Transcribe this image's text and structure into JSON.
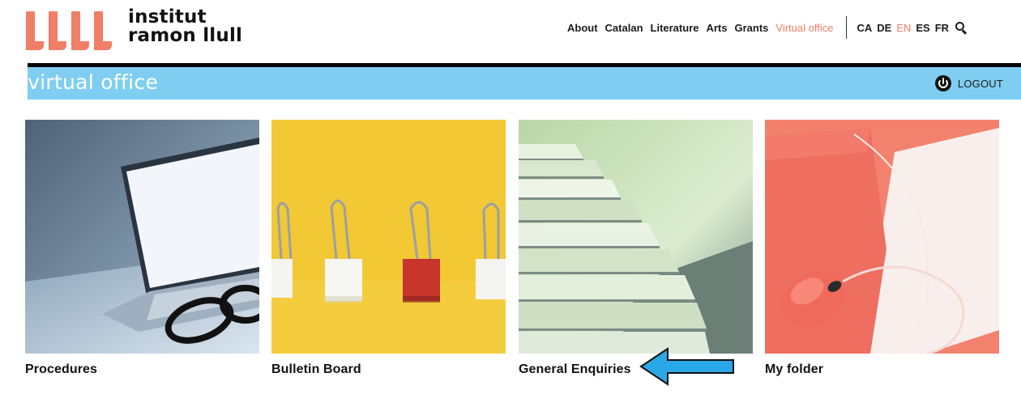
{
  "brand": {
    "logo_line1": "institut",
    "logo_line2": "ramon llull",
    "accent_color": "#ef7f67"
  },
  "nav": {
    "items": [
      "About",
      "Catalan",
      "Literature",
      "Arts",
      "Grants",
      "Virtual office"
    ],
    "active": "Virtual office"
  },
  "languages": {
    "items": [
      "CA",
      "DE",
      "EN",
      "ES",
      "FR"
    ],
    "active": "EN"
  },
  "band": {
    "title": "virtual office",
    "logout_label": "LOGOUT",
    "color": "#7fcef2"
  },
  "cards": [
    {
      "label": "Procedures",
      "image": "laptop-and-glasses-photo"
    },
    {
      "label": "Bulletin Board",
      "image": "binder-clips-photo"
    },
    {
      "label": "General Enquiries",
      "image": "paper-stacks-photo"
    },
    {
      "label": "My folder",
      "image": "folder-and-mouse-photo"
    }
  ],
  "annotation": {
    "icon": "left-arrow-icon",
    "color": "#2aa7e6",
    "points_to": "General Enquiries"
  }
}
